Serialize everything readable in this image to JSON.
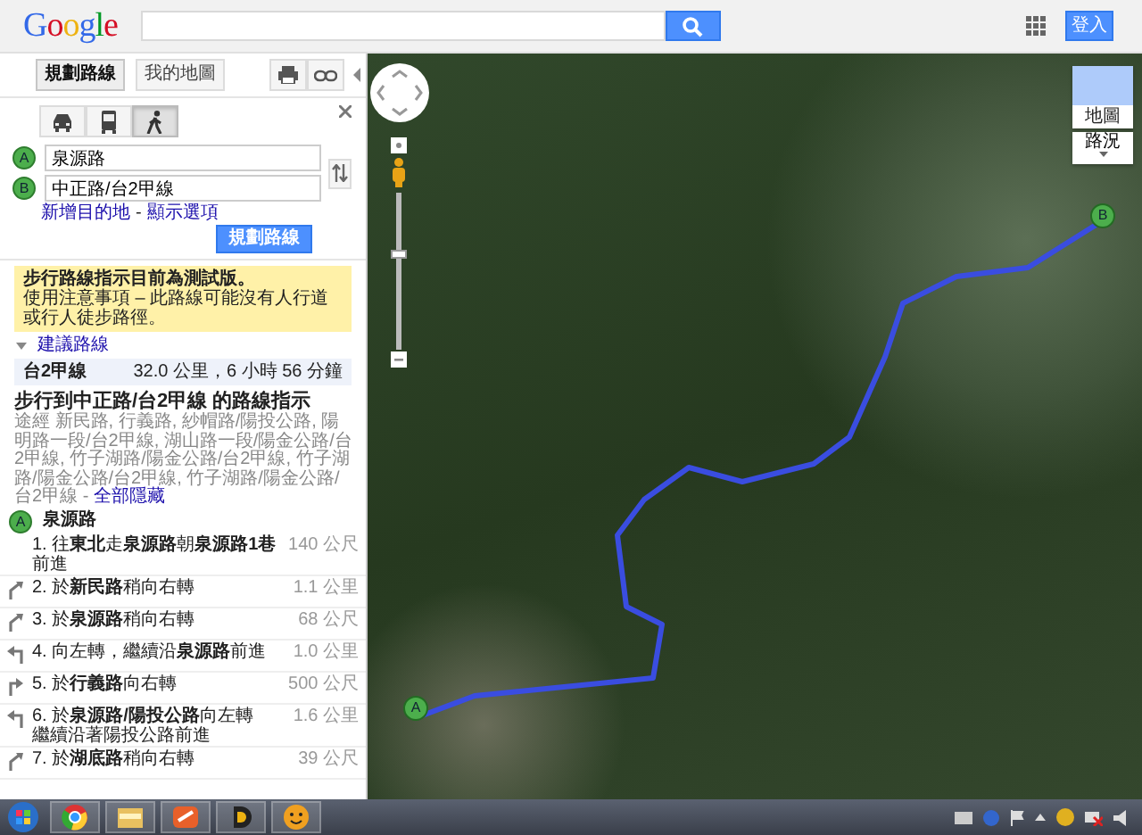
{
  "header": {
    "logo": "Google",
    "sign_in": "登入"
  },
  "panel": {
    "toolbar": [
      {
        "label": "規劃路線",
        "selected": true
      },
      {
        "label": "我的地圖",
        "selected": false
      }
    ],
    "modes": [
      {
        "kind": "car",
        "selected": false
      },
      {
        "kind": "transit",
        "selected": false
      },
      {
        "kind": "walk",
        "selected": true
      }
    ],
    "waypoints": [
      {
        "marker": "A",
        "value": "泉源路"
      },
      {
        "marker": "B",
        "value": "中正路/台2甲線"
      }
    ],
    "add_destination": "新增目的地",
    "separator": "-",
    "show_options": "顯示選項",
    "plan_button": "規劃路線",
    "notice": {
      "title": "步行路線指示目前為測試版。",
      "body": "使用注意事項 – 此路線可能沒有人行道或行人徒步路徑。"
    },
    "suggested": {
      "label": "建議路線",
      "expanded": true,
      "routes": [
        {
          "name": "台2甲線",
          "summary": "32.0 公里，6 小時 56 分鐘",
          "selected": true
        }
      ]
    },
    "directions": {
      "title": "步行到中正路/台2甲線 的路線指示",
      "via": "途經 新民路, 行義路, 紗帽路/陽投公路, 陽明路一段/台2甲線, 湖山路一段/陽金公路/台2甲線, 竹子湖路/陽金公路/台2甲線, 竹子湖路/陽金公路/台2甲線, 竹子湖路/陽金公路/台2甲線 -",
      "hide_all": "全部隱藏",
      "start": {
        "marker": "A",
        "name": "泉源路"
      },
      "steps": [
        {
          "kind": "straight",
          "text": "1. 往**東北**走**泉源路**朝**泉源路1巷**前進",
          "distance": "140 公尺"
        },
        {
          "kind": "slight_right",
          "text": "2. 於**新民路**稍向右轉",
          "distance": "1.1 公里"
        },
        {
          "kind": "slight_right",
          "text": "3. 於**泉源路**稍向右轉",
          "distance": "68 公尺"
        },
        {
          "kind": "left",
          "text": "4. 向左轉，繼續沿**泉源路**前進",
          "distance": "1.0 公里"
        },
        {
          "kind": "right",
          "text": "5. 於**行義路**向右轉",
          "distance": "500 公尺"
        },
        {
          "kind": "left",
          "text": "6. 於**泉源路/陽投公路**向左轉",
          "note": "繼續沿著陽投公路前進",
          "distance": "1.6 公里"
        },
        {
          "kind": "slight_right",
          "text": "7. 於**湖底路**稍向右轉",
          "distance": "39 公尺"
        }
      ]
    }
  },
  "map": {
    "markers": [
      {
        "label": "A"
      },
      {
        "label": "B"
      }
    ],
    "map_type": "地圖",
    "traffic": "路況",
    "zoom": {
      "level": 0.59
    }
  }
}
